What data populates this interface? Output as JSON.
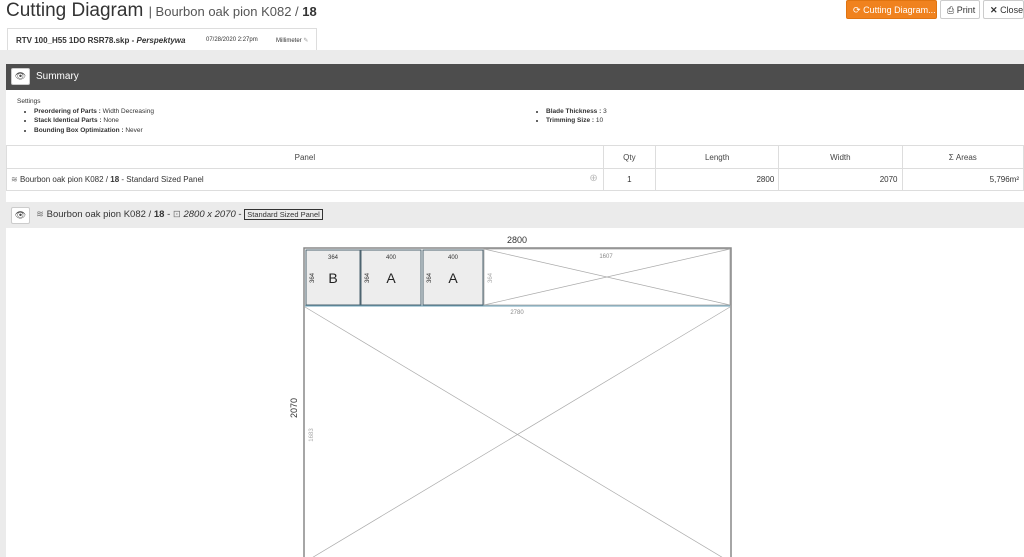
{
  "header": {
    "title": "Cutting Diagram",
    "subtitle_material": "| Bourbon oak pion K082 /",
    "subtitle_thickness": "18",
    "buttons": {
      "cutting_diagram": "Cutting Diagram...",
      "print": "Print",
      "close": "Close"
    }
  },
  "tab": {
    "filename": "RTV 100_H55 1DO RSR78.skp -",
    "scene": "Perspektywa",
    "date": "07/28/2020 2:27pm",
    "unit": "Millimeter"
  },
  "summary": {
    "title": "Summary",
    "settings_title": "Settings",
    "settings_left": [
      {
        "label": "Preordering of Parts :",
        "value": "Width Decreasing"
      },
      {
        "label": "Stack Identical Parts :",
        "value": "None"
      },
      {
        "label": "Bounding Box Optimization :",
        "value": "Never"
      }
    ],
    "settings_right": [
      {
        "label": "Blade Thickness :",
        "value": "3"
      },
      {
        "label": "Trimming Size :",
        "value": "10"
      }
    ],
    "table": {
      "headers": [
        "Panel",
        "Qty",
        "Length",
        "Width",
        "Σ Areas"
      ],
      "row": {
        "material": "Bourbon oak pion K082 /",
        "thickness": "18",
        "suffix": "- Standard Sized Panel",
        "qty": "1",
        "length": "2800",
        "width": "2070",
        "area": "5,796m²"
      }
    }
  },
  "diagram": {
    "header": {
      "material": "Bourbon oak pion K082 /",
      "thickness": "18",
      "sep": "-",
      "size": "2800 x 2070",
      "sep2": "-",
      "badge": "Standard Sized Panel"
    },
    "panel_length": "2800",
    "panel_width": "2070",
    "parts": [
      {
        "label": "B",
        "length": "364",
        "width": "364"
      },
      {
        "label": "A",
        "length": "400",
        "width": "364"
      },
      {
        "label": "A",
        "length": "400",
        "width": "364"
      }
    ],
    "offcut_top_length": "1607",
    "offcut_top_width": "364",
    "strip_length": "2780",
    "offcut_big_width": "1683"
  }
}
